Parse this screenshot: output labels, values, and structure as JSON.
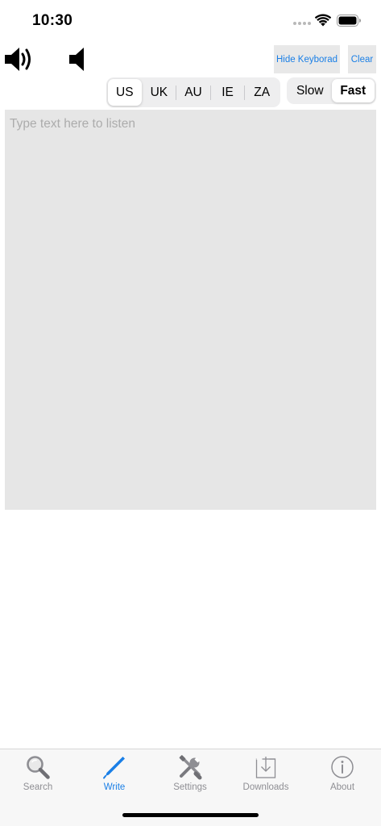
{
  "status_bar": {
    "time": "10:30"
  },
  "toolbar": {
    "hide_keyboard_label": "Hide Keyborad",
    "clear_label": "Clear"
  },
  "accent_selector": {
    "options": [
      "US",
      "UK",
      "AU",
      "IE",
      "ZA"
    ],
    "selected": "US"
  },
  "speed_selector": {
    "options": [
      "Slow",
      "Fast"
    ],
    "selected": "Fast"
  },
  "text_input": {
    "placeholder": "Type text here to listen",
    "value": ""
  },
  "tab_bar": {
    "items": [
      {
        "label": "Search",
        "icon": "magnifier-icon",
        "active": false
      },
      {
        "label": "Write",
        "icon": "pen-icon",
        "active": true
      },
      {
        "label": "Settings",
        "icon": "tools-icon",
        "active": false
      },
      {
        "label": "Downloads",
        "icon": "download-tray-icon",
        "active": false
      },
      {
        "label": "About",
        "icon": "info-icon",
        "active": false
      }
    ]
  },
  "colors": {
    "accent": "#1a7fe6",
    "inactive": "#8e8e93",
    "panel": "#e6e6e6"
  }
}
